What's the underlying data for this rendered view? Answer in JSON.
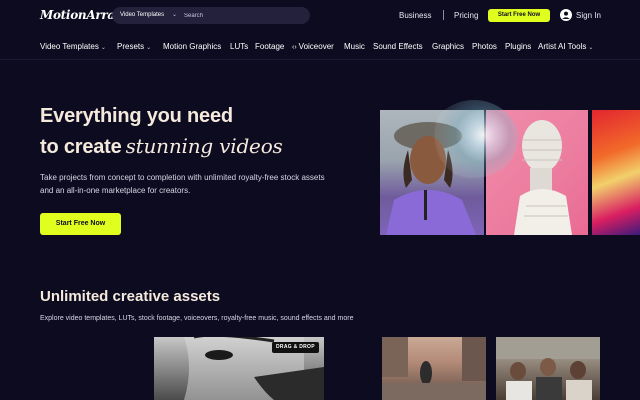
{
  "header": {
    "logo": "MotionArray",
    "search": {
      "category": "Video Templates",
      "placeholder": "Search"
    },
    "links": {
      "business": "Business",
      "pricing": "Pricing"
    },
    "cta": "Start Free Now",
    "signin": "Sign In"
  },
  "nav": {
    "items": [
      {
        "label": "Video Templates",
        "dropdown": true
      },
      {
        "label": "Presets",
        "dropdown": true
      },
      {
        "label": "Motion Graphics",
        "dropdown": false
      },
      {
        "label": "LUTs",
        "dropdown": false
      },
      {
        "label": "Footage",
        "dropdown": false
      },
      {
        "label": "Voiceover",
        "dropdown": false,
        "icon": "voiceover-icon"
      },
      {
        "label": "Music",
        "dropdown": false
      },
      {
        "label": "Sound Effects",
        "dropdown": false
      },
      {
        "label": "Graphics",
        "dropdown": false
      },
      {
        "label": "Photos",
        "dropdown": false
      },
      {
        "label": "Plugins",
        "dropdown": false
      },
      {
        "label": "Artist AI Tools",
        "dropdown": true
      }
    ]
  },
  "hero": {
    "title_line1": "Everything you need",
    "title_line2_prefix": "to create",
    "title_line2_accent": "stunning videos",
    "description": "Take projects from concept to completion with unlimited royalty-free stock assets and an all-in-one marketplace for creators.",
    "cta": "Start Free Now"
  },
  "assets": {
    "title": "Unlimited creative assets",
    "description": "Explore video templates, LUTs, stock footage, voiceovers, royalty-free music, sound effects and more",
    "badge": "DRAG & DROP"
  },
  "colors": {
    "background": "#0c0b1f",
    "accent": "#e0ff1f",
    "heading": "#f4e9dc"
  }
}
